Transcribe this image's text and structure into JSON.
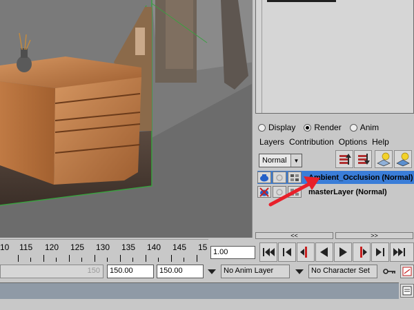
{
  "layer_editor": {
    "modes": [
      {
        "label": "Display",
        "selected": false
      },
      {
        "label": "Render",
        "selected": true
      },
      {
        "label": "Anim",
        "selected": false
      }
    ],
    "menu": [
      "Layers",
      "Contribution",
      "Options",
      "Help"
    ],
    "blend_mode": "Normal",
    "layers": [
      {
        "name": "Ambient_Occlusion (Normal)",
        "active": true
      },
      {
        "name": "masterLayer (Normal)",
        "active": false
      }
    ],
    "nav_prev": "<<",
    "nav_next": ">>"
  },
  "timeline": {
    "ticks": [
      "10",
      "115",
      "120",
      "125",
      "130",
      "135",
      "140",
      "145",
      "15"
    ],
    "current_time": "1.00"
  },
  "range": {
    "slider_end": "150",
    "start": "150.00",
    "end": "150.00",
    "anim_layer": "No Anim Layer",
    "character_set": "No Character Set"
  },
  "colors": {
    "active_layer": "#3a7dd8",
    "annotation_arrow": "#e8202a",
    "status_bar": "#8f9aa6"
  }
}
